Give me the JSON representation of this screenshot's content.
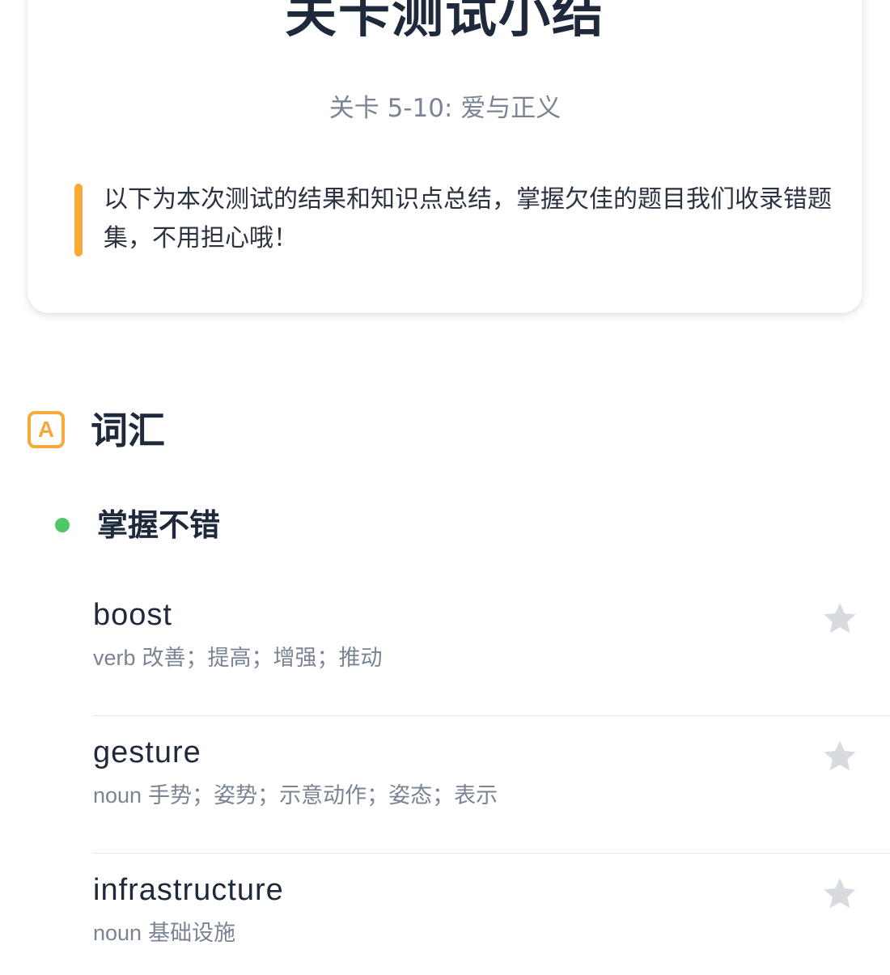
{
  "summary": {
    "title": "关卡测试小结",
    "subtitle": "关卡 5-10: 爱与正义",
    "notice": "以下为本次测试的结果和知识点总结，掌握欠佳的题目我们收录错题集，不用担心哦！"
  },
  "vocab_section": {
    "icon_letter": "A",
    "title": "词汇",
    "group_title": "掌握不错",
    "words": [
      {
        "word": "boost",
        "pos": "verb",
        "meaning": "改善；提高；增强；推动"
      },
      {
        "word": "gesture",
        "pos": "noun",
        "meaning": "手势；姿势；示意动作；姿态；表示"
      },
      {
        "word": "infrastructure",
        "pos": "noun",
        "meaning": "基础设施"
      }
    ]
  },
  "colors": {
    "accent_orange": "#f7a93a",
    "status_green": "#4cc866",
    "star_gray": "#d7dbe0"
  }
}
